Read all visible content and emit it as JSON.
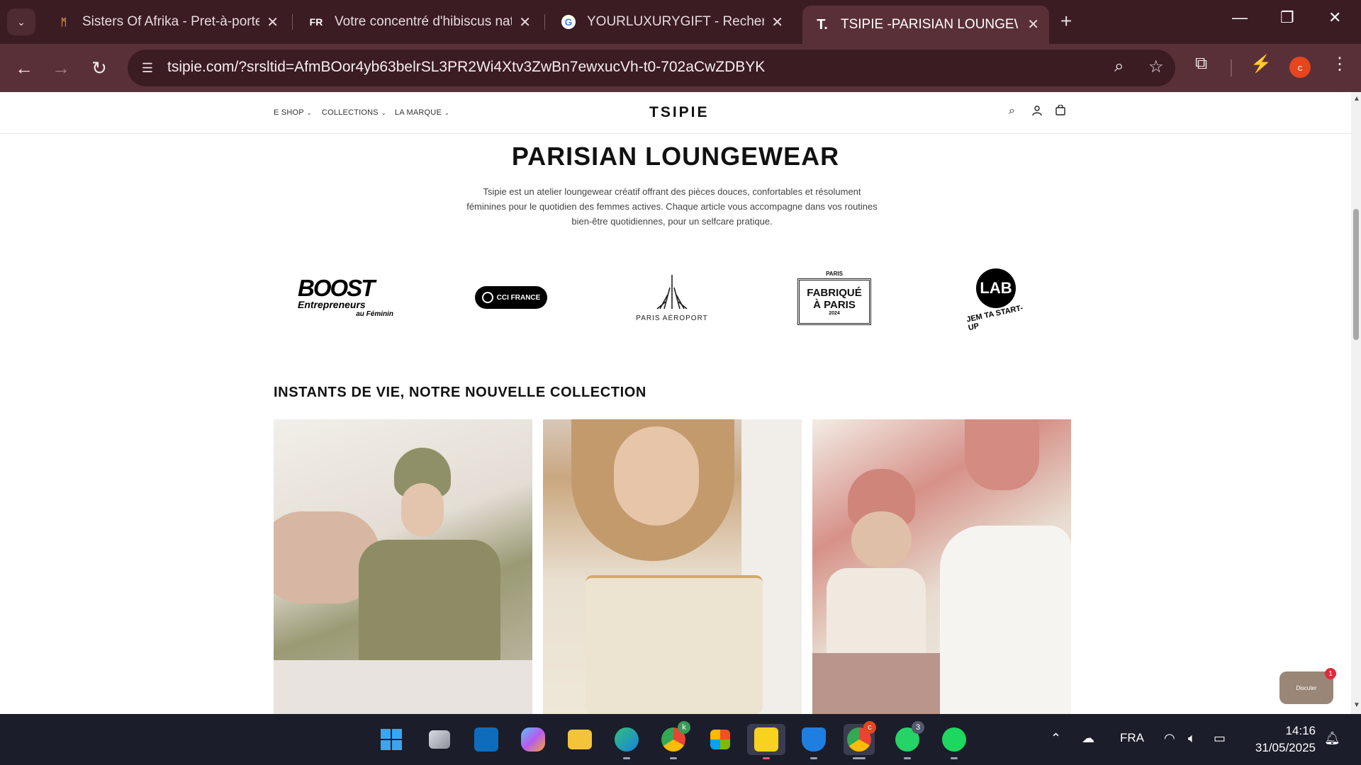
{
  "browser": {
    "tabs": [
      {
        "title": "Sisters Of Afrika - Pret-à-porter",
        "favicon": "sisters-of-afrika-icon",
        "active": false
      },
      {
        "title": "Votre concentré d'hibiscus natu",
        "favicon": "fr-icon",
        "favicon_text": "FR",
        "active": false
      },
      {
        "title": "YOURLUXURYGIFT - Recherche",
        "favicon": "google-icon",
        "active": false
      },
      {
        "title": "TSIPIE -PARISIAN LOUNGEWEAR",
        "favicon": "tsipie-icon",
        "favicon_text": "T.",
        "active": true
      }
    ],
    "url": "tsipie.com/?srsltid=AfmBOor4yb63belrSL3PR2Wi4Xtv3ZwBn7ewxucVh-t0-702aCwZDBYK",
    "profile_initial": "c"
  },
  "site": {
    "menu": [
      "E SHOP",
      "COLLECTIONS",
      "LA MARQUE"
    ],
    "brand": "TSIPIE",
    "hero_title": "PARISIAN LOUNGEWEAR",
    "hero_text": "Tsipie est un atelier loungewear créatif offrant des pièces douces, confortables et résolument féminines pour le quotidien des femmes actives. Chaque article vous accompagne dans vos routines bien-être quotidiennes, pour un selfcare pratique.",
    "logos": {
      "boost": {
        "main": "BOOST",
        "sub": "Entrepreneurs",
        "sub2": "au Féminin"
      },
      "cci": "CCI FRANCE",
      "paris_aeroport": "PARIS AÉROPORT",
      "fabrique": {
        "top": "PARIS",
        "line1": "FABRIQUÉ",
        "line2": "À PARIS",
        "year": "2024"
      },
      "lab": {
        "main": "LAB",
        "sub": "JEM TA START-UP"
      }
    },
    "section_title": "INSTANTS DE VIE, NOTRE NOUVELLE COLLECTION",
    "chat_label": "Discuter",
    "chat_badge": "1"
  },
  "taskbar": {
    "whatsapp_badge": "3",
    "chrome_badge": "k",
    "chrome2_badge": "c",
    "language": "FRA",
    "time": "14:16",
    "date": "31/05/2025"
  },
  "colors": {
    "tabbar": "#3b1c23",
    "toolbar": "#5a3038",
    "taskbar": "#1b1d2a",
    "profile": "#e5461e"
  }
}
